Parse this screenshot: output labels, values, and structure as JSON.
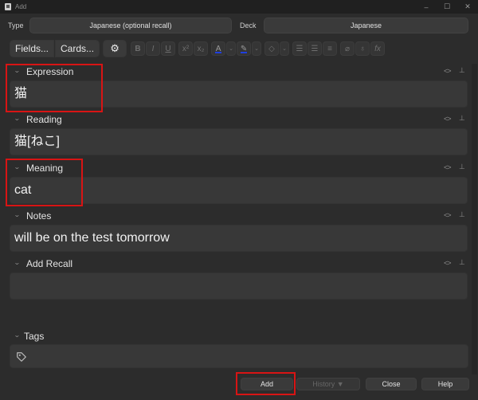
{
  "window": {
    "title": "Add",
    "controls": {
      "minimize": "–",
      "maximize": "☐",
      "close": "✕"
    }
  },
  "note_type": {
    "label": "Type",
    "value": "Japanese (optional recall)"
  },
  "deck": {
    "label": "Deck",
    "value": "Japanese"
  },
  "toolbar": {
    "fields_label": "Fields...",
    "cards_label": "Cards...",
    "icons": [
      "gear-icon",
      "bold-icon",
      "italic-icon",
      "underline-icon",
      "superscript-icon",
      "subscript-icon",
      "text-color-icon",
      "highlight-color-icon",
      "eraser-icon",
      "unordered-list-icon",
      "ordered-list-icon",
      "justify-icon",
      "attachment-icon",
      "microphone-icon",
      "math-icon"
    ],
    "text_color": "#1f3fe0",
    "highlight_color": "#1f3fe0"
  },
  "fields": [
    {
      "name": "Expression",
      "value": "猫",
      "highlighted": true
    },
    {
      "name": "Reading",
      "value": "猫[ねこ]",
      "highlighted": false
    },
    {
      "name": "Meaning",
      "value": "cat",
      "highlighted": true
    },
    {
      "name": "Notes",
      "value": "will be on the test tomorrow",
      "highlighted": false
    },
    {
      "name": "Add Recall",
      "value": "",
      "highlighted": false
    }
  ],
  "field_icons": {
    "html_toggle": "<>",
    "pin": "⊥"
  },
  "tags": {
    "label": "Tags",
    "value": ""
  },
  "buttons": {
    "add": "Add",
    "history": "History ▼",
    "close": "Close",
    "help": "Help"
  },
  "highlight_color": "#d81414"
}
